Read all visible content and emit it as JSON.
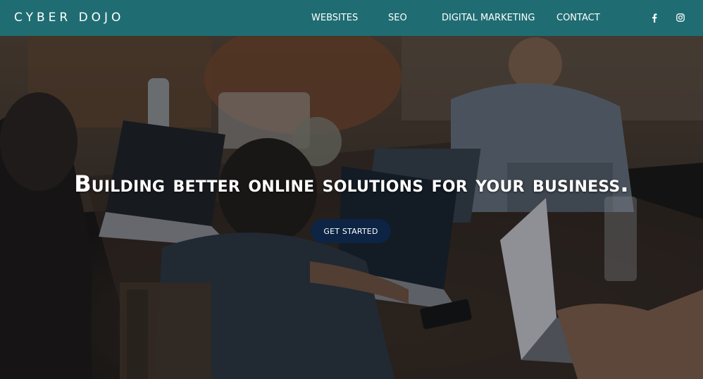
{
  "header": {
    "logo": "CYBER DOJO",
    "nav": [
      "WEBSITES",
      "SEO",
      "DIGITAL MARKETING",
      "CONTACT"
    ],
    "social": [
      "facebook-icon",
      "instagram-icon"
    ],
    "background_color": "#1f6d73"
  },
  "hero": {
    "headline": "Building better online solutions for your business.",
    "cta_label": "GET STARTED",
    "cta_color": "#0d2444"
  }
}
